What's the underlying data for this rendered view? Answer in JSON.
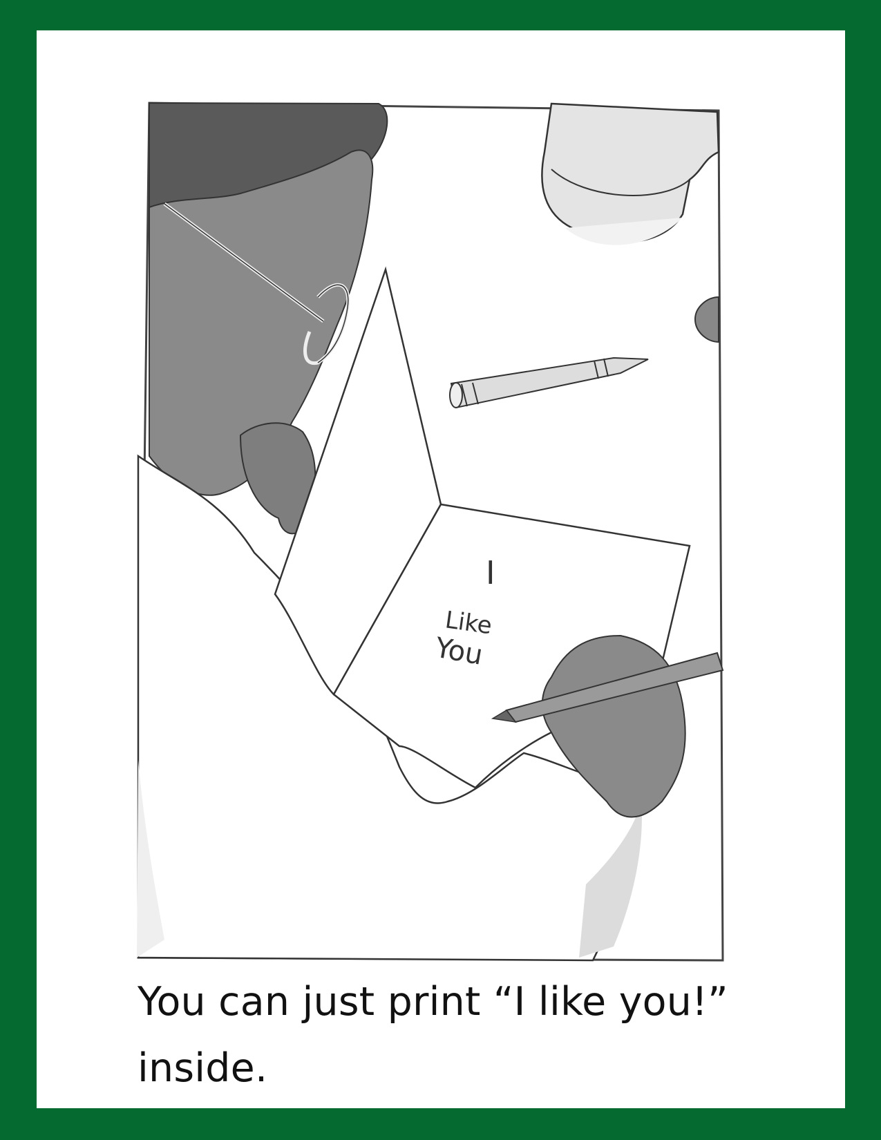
{
  "page": {
    "caption_lines": [
      "You can just print “I like you!”",
      "inside."
    ],
    "colors": {
      "border": "#046a30",
      "page": "#ffffff",
      "ink": "#333333",
      "skin": "#8a8a8a",
      "hair": "#5a5a5a",
      "shadow": "#d4d4d4"
    }
  },
  "illustration": {
    "handwriting": [
      "I",
      "Like",
      "You"
    ]
  }
}
